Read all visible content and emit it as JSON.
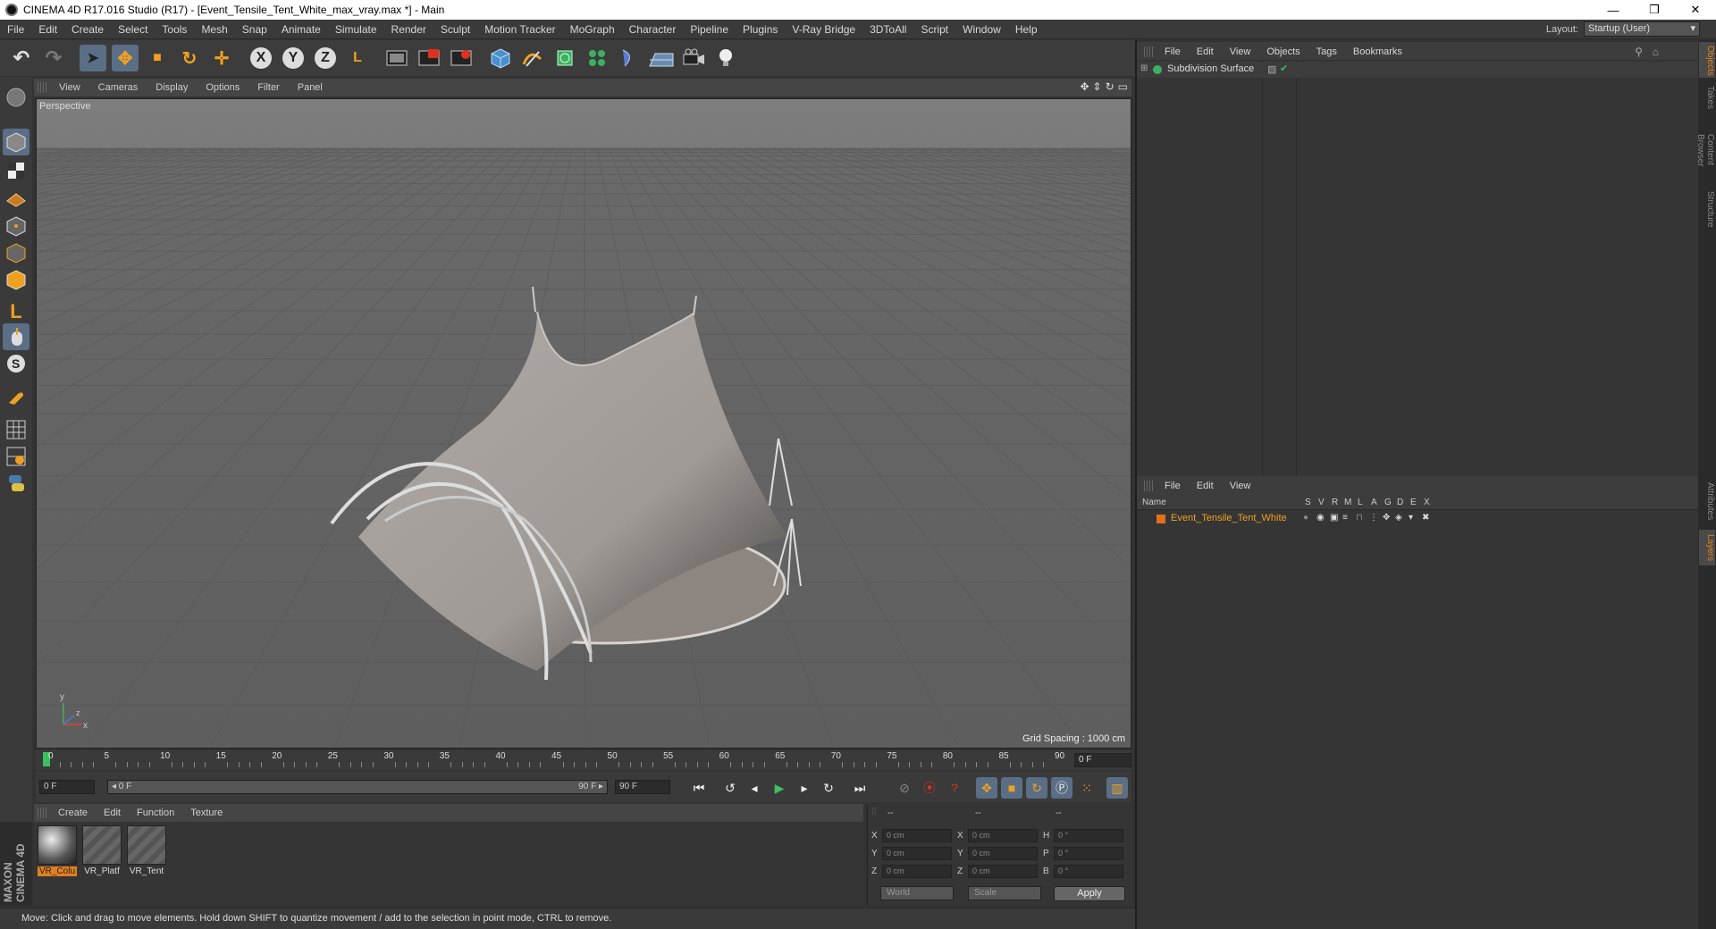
{
  "window": {
    "title": "CINEMA 4D R17.016 Studio (R17) - [Event_Tensile_Tent_White_max_vray.max *] - Main",
    "minimize": "—",
    "restore": "❐",
    "close": "✕"
  },
  "menubar": {
    "items": [
      "File",
      "Edit",
      "Create",
      "Select",
      "Tools",
      "Mesh",
      "Snap",
      "Animate",
      "Simulate",
      "Render",
      "Sculpt",
      "Motion Tracker",
      "MoGraph",
      "Character",
      "Pipeline",
      "Plugins",
      "V-Ray Bridge",
      "3DToAll",
      "Script",
      "Window",
      "Help"
    ],
    "layout_label": "Layout:",
    "layout_value": "Startup (User)"
  },
  "toolbar": {
    "undo": "↶",
    "redo": "↷",
    "select": "➤",
    "move": "✥",
    "scale": "■",
    "rotate": "↻",
    "add": "✛",
    "x_axis": "X",
    "y_axis": "Y",
    "z_axis": "Z",
    "coord_system": "L"
  },
  "viewport": {
    "menu": [
      "View",
      "Cameras",
      "Display",
      "Options",
      "Filter",
      "Panel"
    ],
    "camera_label": "Perspective",
    "grid_spacing": "Grid Spacing : 1000 cm",
    "axis_y": "y",
    "axis_x": "x",
    "axis_z": "z"
  },
  "timeline": {
    "ticks": [
      "0",
      "5",
      "10",
      "15",
      "20",
      "25",
      "30",
      "35",
      "40",
      "45",
      "50",
      "55",
      "60",
      "65",
      "70",
      "75",
      "80",
      "85",
      "90"
    ],
    "current_frame": "0 F"
  },
  "transport": {
    "start_field": "0 F",
    "range_start": "◂ 0 F",
    "range_end": "90 F ▸",
    "end_field": "90 F"
  },
  "materials": {
    "menu": [
      "Create",
      "Edit",
      "Function",
      "Texture"
    ],
    "items": [
      {
        "name": "VR_Colu",
        "selected": true
      },
      {
        "name": "VR_Platf",
        "selected": false
      },
      {
        "name": "VR_Tent",
        "selected": false
      }
    ]
  },
  "coordinates": {
    "header": [
      "--",
      "--",
      "--"
    ],
    "rows": [
      {
        "l1": "X",
        "v1": "0 cm",
        "l2": "X",
        "v2": "0 cm",
        "l3": "H",
        "v3": "0 °"
      },
      {
        "l1": "Y",
        "v1": "0 cm",
        "l2": "Y",
        "v2": "0 cm",
        "l3": "P",
        "v3": "0 °"
      },
      {
        "l1": "Z",
        "v1": "0 cm",
        "l2": "Z",
        "v2": "0 cm",
        "l3": "B",
        "v3": "0 °"
      }
    ],
    "mode": "World",
    "transform": "Scale",
    "apply": "Apply"
  },
  "status": {
    "text": "Move: Click and drag to move elements. Hold down SHIFT to quantize movement / add to the selection in point mode, CTRL to remove."
  },
  "objects_panel": {
    "menu": [
      "File",
      "Edit",
      "View",
      "Objects",
      "Tags",
      "Bookmarks"
    ],
    "object_name": "Subdivision Surface"
  },
  "layers_panel": {
    "menu": [
      "File",
      "Edit",
      "View"
    ],
    "columns": [
      "Name",
      "S",
      "V",
      "R",
      "M",
      "L",
      "A",
      "G",
      "D",
      "E",
      "X"
    ],
    "layer_name": "Event_Tensile_Tent_White",
    "layer_color": "#e0701c"
  },
  "side_tabs": [
    "Objects",
    "Takes",
    "Content Browser",
    "Structure",
    "Attributes",
    "Layers"
  ],
  "maxon_logo": "MAXON CINEMA 4D",
  "colors": {
    "accent_orange": "#e08020",
    "active_blue": "#5a6e86"
  }
}
